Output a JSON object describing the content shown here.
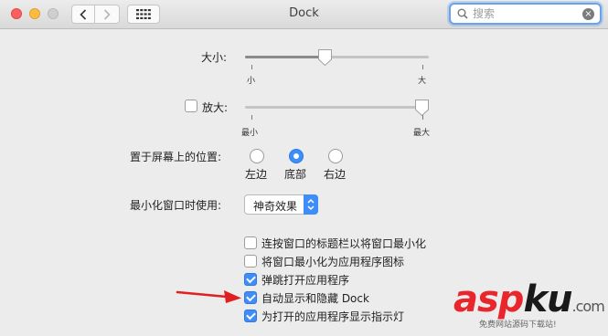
{
  "window": {
    "title": "Dock",
    "colors": {
      "close": "#fc605c",
      "minimize": "#fdbc40",
      "zoom_disabled": "#cfcfcf",
      "accent": "#3d8dfa"
    }
  },
  "toolbar": {
    "back_icon": "chevron-left-icon",
    "forward_icon": "chevron-right-icon",
    "grid_icon": "show-all-grid-icon"
  },
  "search": {
    "placeholder": "搜索",
    "value": ""
  },
  "size": {
    "label": "大小:",
    "min_label": "小",
    "max_label": "大",
    "value_fraction": 0.43
  },
  "magnification": {
    "checkbox_label": "放大:",
    "checked": false,
    "min_label": "最小",
    "max_label": "最大",
    "value_fraction": 0.97
  },
  "position": {
    "label": "置于屏幕上的位置:",
    "options": [
      {
        "label": "左边",
        "selected": false
      },
      {
        "label": "底部",
        "selected": true
      },
      {
        "label": "右边",
        "selected": false
      }
    ]
  },
  "minimize": {
    "label": "最小化窗口时使用:",
    "selected": "神奇效果"
  },
  "options": [
    {
      "label": "连按窗口的标题栏以将窗口最小化",
      "checked": false
    },
    {
      "label": "将窗口最小化为应用程序图标",
      "checked": false
    },
    {
      "label": "弹跳打开应用程序",
      "checked": true
    },
    {
      "label": "自动显示和隐藏 Dock",
      "checked": true
    },
    {
      "label": "为打开的应用程序显示指示灯",
      "checked": true
    }
  ],
  "watermark": {
    "part1": "asp",
    "part2": "ku",
    "suffix": ".com",
    "subtitle": "免费网站源码下载站!"
  }
}
